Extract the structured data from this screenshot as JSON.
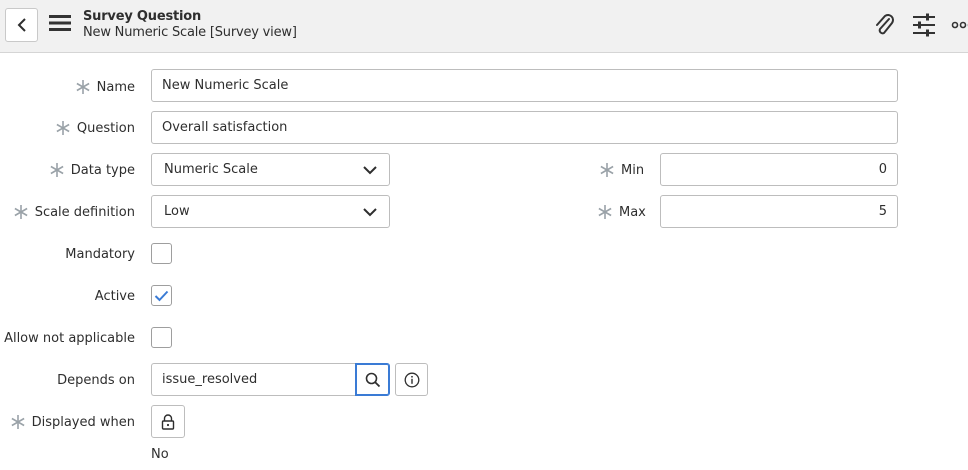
{
  "header": {
    "title": "Survey Question",
    "subtitle": "New Numeric Scale [Survey view]"
  },
  "form": {
    "name": {
      "label": "Name",
      "value": "New Numeric Scale",
      "required": true
    },
    "question": {
      "label": "Question",
      "value": "Overall satisfaction",
      "required": true
    },
    "data_type": {
      "label": "Data type",
      "value": "Numeric Scale",
      "required": true
    },
    "min": {
      "label": "Min",
      "value": "0",
      "required": true
    },
    "scale_definition": {
      "label": "Scale definition",
      "value": "Low",
      "required": true
    },
    "max": {
      "label": "Max",
      "value": "5",
      "required": true
    },
    "mandatory": {
      "label": "Mandatory",
      "checked": false
    },
    "active": {
      "label": "Active",
      "checked": true
    },
    "allow_not_applicable": {
      "label": "Allow not applicable",
      "checked": false
    },
    "depends_on": {
      "label": "Depends on",
      "value": "issue_resolved"
    },
    "displayed_when": {
      "label": "Displayed when",
      "required": true,
      "value_text": "No"
    }
  },
  "colors": {
    "header_bg": "#f1f1f1",
    "required_star": "#9aa2a8",
    "check_blue": "#3a7bd5",
    "focus_blue": "#3a7bd5"
  }
}
